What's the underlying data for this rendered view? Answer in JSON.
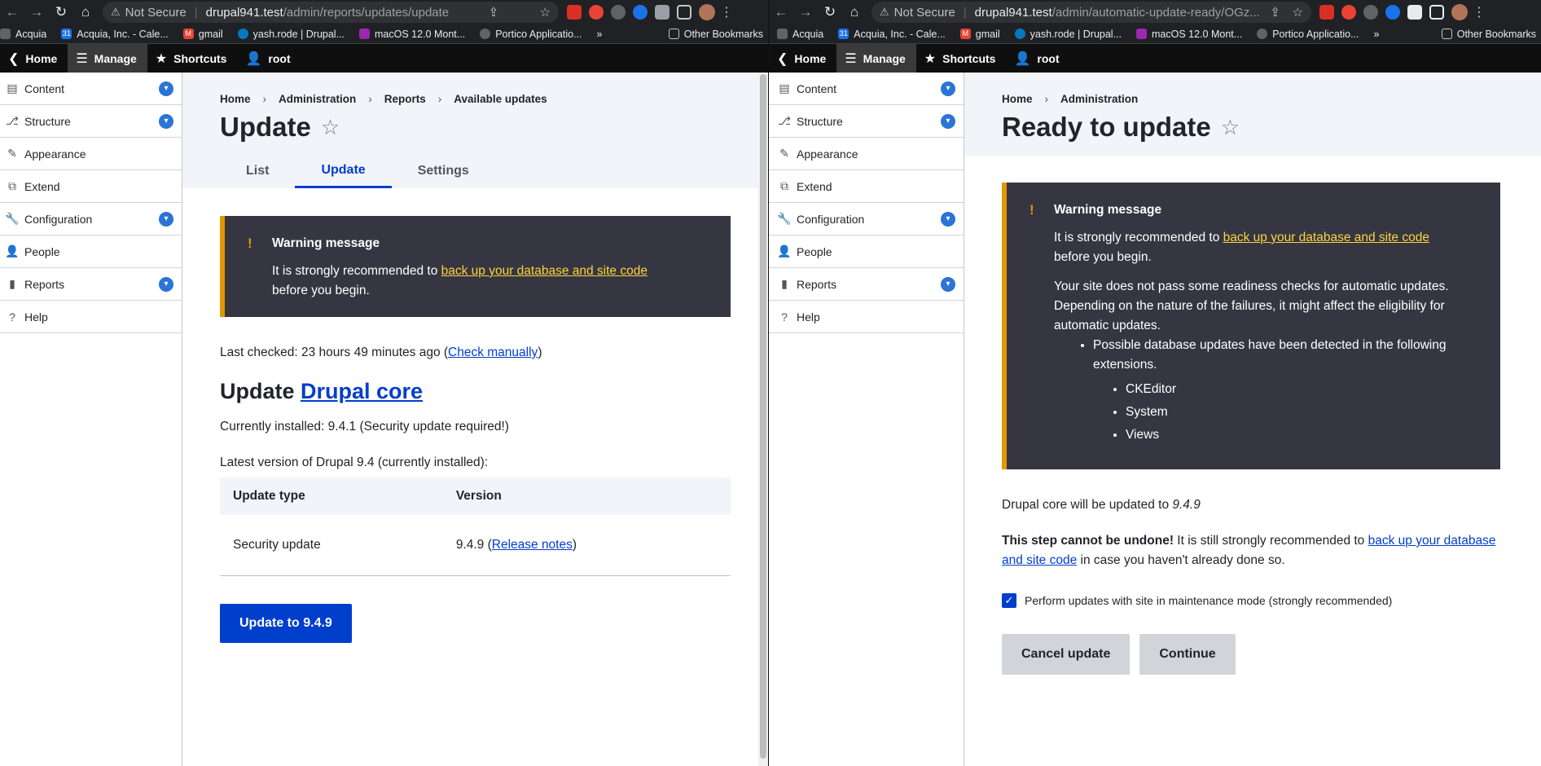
{
  "left": {
    "url": {
      "not_secure": "Not Secure",
      "host": "drupal941.test",
      "path": "/admin/reports/updates/update"
    },
    "bookmarks": [
      "Acquia",
      "Acquia, Inc. - Cale...",
      "gmail",
      "yash.rode | Drupal...",
      "macOS 12.0 Mont...",
      "Portico Applicatio..."
    ],
    "other_bookmarks": "Other Bookmarks",
    "more_bookmarks": "»",
    "toolbar": {
      "home": "Home",
      "manage": "Manage",
      "shortcuts": "Shortcuts",
      "user": "root"
    },
    "sidebar": [
      "Content",
      "Structure",
      "Appearance",
      "Extend",
      "Configuration",
      "People",
      "Reports",
      "Help"
    ],
    "breadcrumb": [
      "Home",
      "Administration",
      "Reports",
      "Available updates"
    ],
    "title": "Update",
    "tabs": [
      "List",
      "Update",
      "Settings"
    ],
    "warning": {
      "title": "Warning message",
      "text_before": "It is strongly recommended to ",
      "link": "back up your database and site code",
      "text_after": "before you begin."
    },
    "last_checked": "Last checked: 23 hours 49 minutes ago (",
    "check_manually": "Check manually",
    "close_paren": ")",
    "update_heading": "Update ",
    "drupal_core": "Drupal core",
    "currently_installed": "Currently installed: 9.4.1 (Security update required!)",
    "latest_version": "Latest version of Drupal 9.4 (currently installed):",
    "table": {
      "headers": [
        "Update type",
        "Version"
      ],
      "rows": [
        {
          "type": "Security update",
          "version": "9.4.9 (",
          "notes": "Release notes",
          "close": ")"
        }
      ]
    },
    "update_button": "Update to 9.4.9"
  },
  "right": {
    "url": {
      "not_secure": "Not Secure",
      "host": "drupal941.test",
      "path": "/admin/automatic-update-ready/OGz..."
    },
    "bookmarks": [
      "Acquia",
      "Acquia, Inc. - Cale...",
      "gmail",
      "yash.rode | Drupal...",
      "macOS 12.0 Mont...",
      "Portico Applicatio..."
    ],
    "other_bookmarks": "Other Bookmarks",
    "more_bookmarks": "»",
    "toolbar": {
      "home": "Home",
      "manage": "Manage",
      "shortcuts": "Shortcuts",
      "user": "root"
    },
    "sidebar": [
      "Content",
      "Structure",
      "Appearance",
      "Extend",
      "Configuration",
      "People",
      "Reports",
      "Help"
    ],
    "breadcrumb": [
      "Home",
      "Administration"
    ],
    "title": "Ready to update",
    "warning": {
      "title": "Warning message",
      "text_before": "It is strongly recommended to ",
      "link": "back up your database and site code",
      "text_after": "before you begin.",
      "readiness": "Your site does not pass some readiness checks for automatic updates. Depending on the nature of the failures, it might affect the eligibility for automatic updates.",
      "db_updates": "Possible database updates have been detected in the following extensions.",
      "extensions": [
        "CKEditor",
        "System",
        "Views"
      ]
    },
    "core_will_update": "Drupal core will be updated to ",
    "core_version": "9.4.9",
    "undone_bold": "This step cannot be undone!",
    "undone_text": " It is still strongly recommended to ",
    "undone_link": "back up your database and site code",
    "undone_after": " in case you haven't already done so.",
    "maintenance_label": "Perform updates with site in maintenance mode (strongly recommended)",
    "maintenance_checked": true,
    "cancel_button": "Cancel update",
    "continue_button": "Continue"
  },
  "colors": {
    "primary": "#003ecc",
    "warning_bg": "#353641",
    "warning_accent": "#e29700",
    "warning_link": "#ffd23f"
  }
}
